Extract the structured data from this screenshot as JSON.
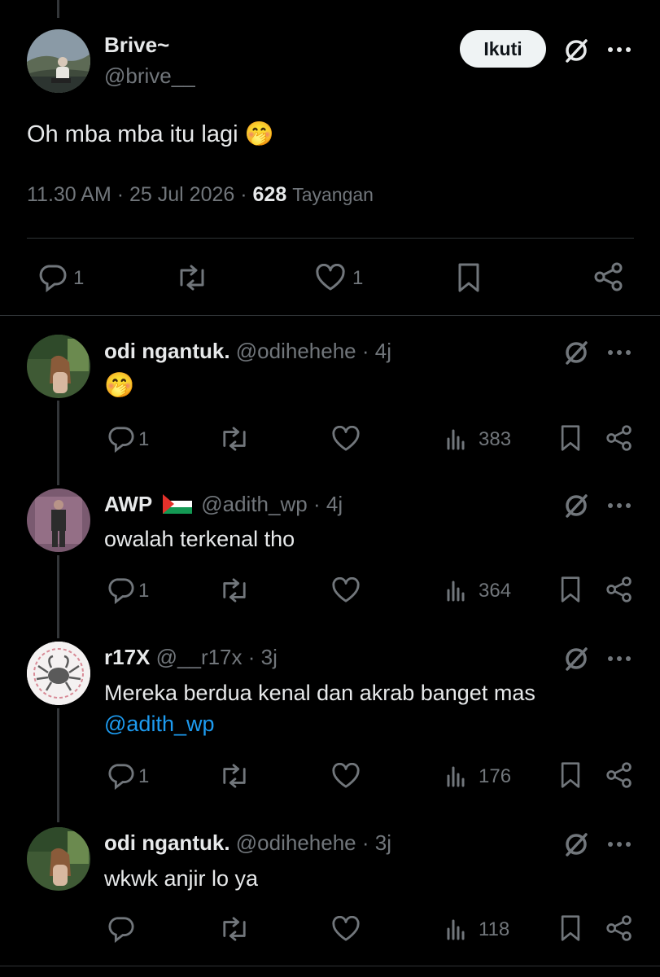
{
  "main_post": {
    "display_name": "Brive~",
    "handle": "@brive__",
    "follow_label": "Ikuti",
    "text": "Oh mba mba itu lagi",
    "emoji": "🤭",
    "time": "11.30 AM",
    "date": "25 Jul 2026",
    "views": "628",
    "views_label": "Tayangan",
    "reply_count": "1",
    "like_count": "1"
  },
  "replies": [
    {
      "display_name": "odi ngantuk.",
      "handle": "@odihehehe",
      "age": "4j",
      "text": "🤭",
      "reply_count": "1",
      "views": "383"
    },
    {
      "display_name": "AWP",
      "handle": "@adith_wp",
      "age": "4j",
      "text": "owalah terkenal tho",
      "reply_count": "1",
      "views": "364"
    },
    {
      "display_name": "r17X",
      "handle": "@__r17x",
      "age": "3j",
      "text_line1": "Mereka berdua kenal dan akrab banget mas",
      "mention": "@adith_wp",
      "reply_count": "1",
      "views": "176"
    },
    {
      "display_name": "odi ngantuk.",
      "handle": "@odihehehe",
      "age": "3j",
      "text": "wkwk anjir lo ya",
      "reply_count": "",
      "views": "118"
    }
  ],
  "separator": "·",
  "colors": {
    "background": "#000000",
    "text": "#e7e9ea",
    "muted": "#71767b",
    "link": "#1d9bf0",
    "divider": "#2f3336"
  }
}
